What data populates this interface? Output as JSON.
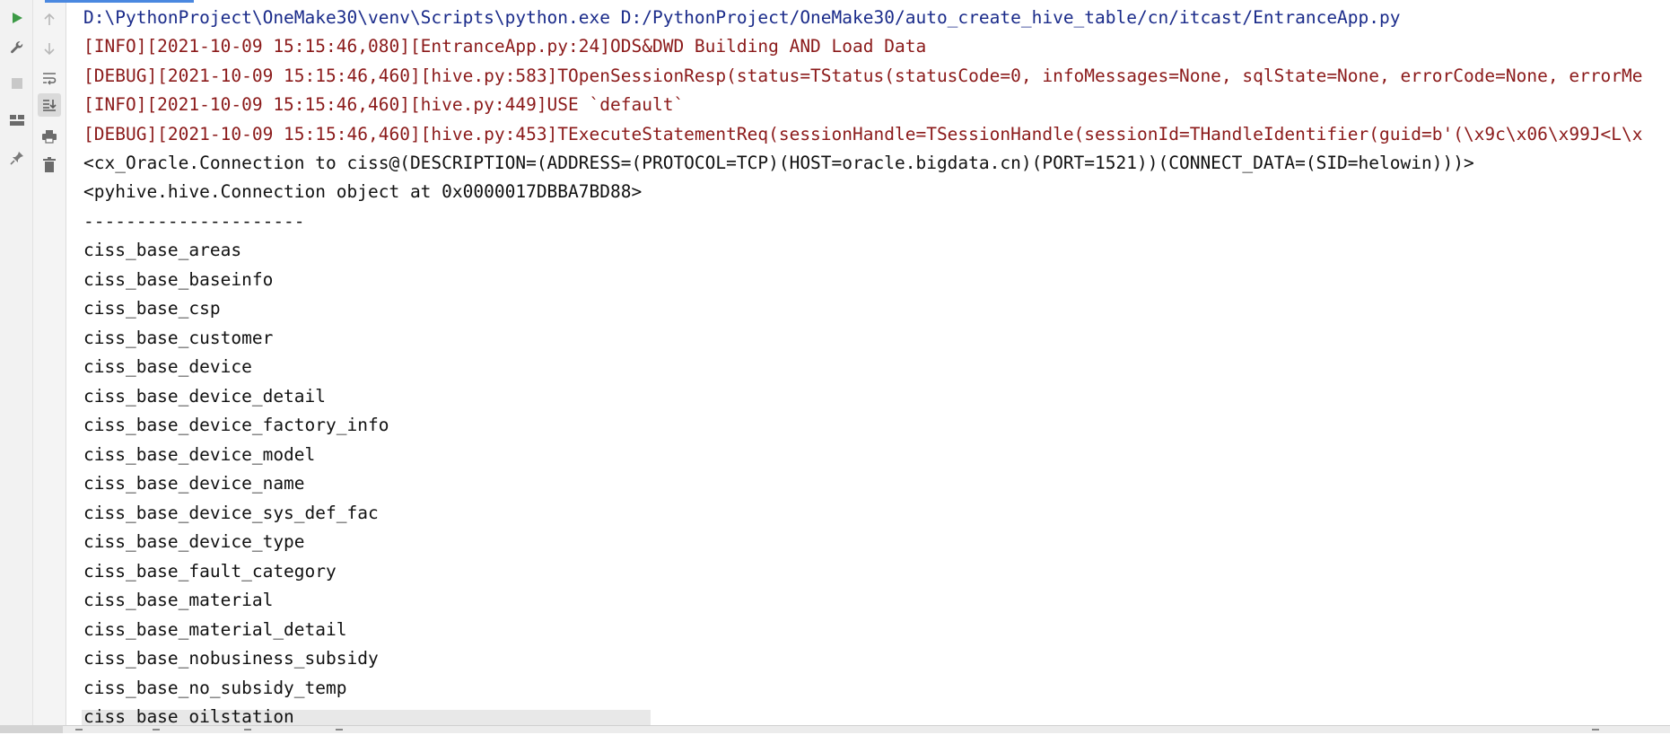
{
  "toolbar": {
    "run_icon": "play-icon",
    "settings_icon": "wrench-icon",
    "stop_icon": "stop-icon",
    "layout_icon": "layout-icon",
    "pin_icon": "pin-icon",
    "up_icon": "arrow-up-icon",
    "down_icon": "arrow-down-icon",
    "wrap_icon": "soft-wrap-icon",
    "scroll_icon": "scroll-to-end-icon",
    "print_icon": "print-icon",
    "trash_icon": "trash-icon"
  },
  "colors": {
    "command": "#1a2b8a",
    "log": "#8b1a1a",
    "output": "#111111",
    "run_green": "#3c9a46"
  },
  "console": {
    "lines": [
      "D:\\PythonProject\\OneMake30\\venv\\Scripts\\python.exe D:/PythonProject/OneMake30/auto_create_hive_table/cn/itcast/EntranceApp.py",
      "[INFO][2021-10-09 15:15:46,080][EntranceApp.py:24]ODS&DWD Building AND Load Data",
      "[DEBUG][2021-10-09 15:15:46,460][hive.py:583]TOpenSessionResp(status=TStatus(statusCode=0, infoMessages=None, sqlState=None, errorCode=None, errorMe",
      "[INFO][2021-10-09 15:15:46,460][hive.py:449]USE `default`",
      "[DEBUG][2021-10-09 15:15:46,460][hive.py:453]TExecuteStatementReq(sessionHandle=TSessionHandle(sessionId=THandleIdentifier(guid=b'(\\x9c\\x06\\x99J<L\\x",
      "<cx_Oracle.Connection to ciss@(DESCRIPTION=(ADDRESS=(PROTOCOL=TCP)(HOST=oracle.bigdata.cn)(PORT=1521))(CONNECT_DATA=(SID=helowin)))>",
      "<pyhive.hive.Connection object at 0x0000017DBBA7BD88>",
      "---------------------",
      "ciss_base_areas",
      "ciss_base_baseinfo",
      "ciss_base_csp",
      "ciss_base_customer",
      "ciss_base_device",
      "ciss_base_device_detail",
      "ciss_base_device_factory_info",
      "ciss_base_device_model",
      "ciss_base_device_name",
      "ciss_base_device_sys_def_fac",
      "ciss_base_device_type",
      "ciss_base_fault_category",
      "ciss_base_material",
      "ciss_base_material_detail",
      "ciss_base_nobusiness_subsidy",
      "ciss_base_no_subsidy_temp",
      "ciss_base_oilstation"
    ]
  }
}
